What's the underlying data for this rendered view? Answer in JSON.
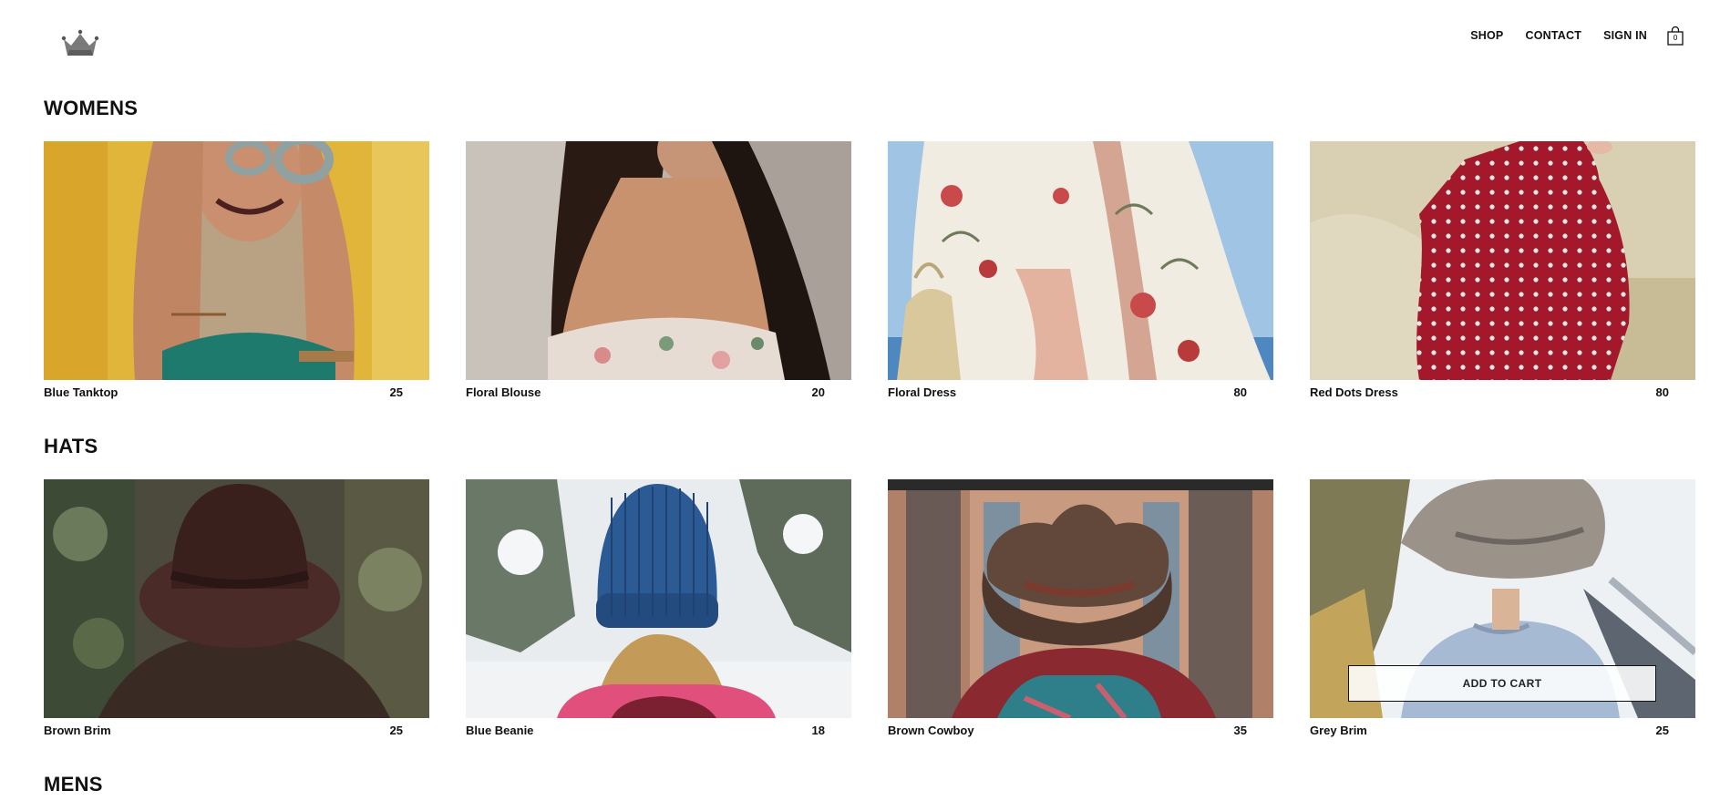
{
  "header": {
    "logo": "crown-logo-icon",
    "nav": [
      {
        "label": "SHOP"
      },
      {
        "label": "CONTACT"
      },
      {
        "label": "SIGN IN"
      }
    ],
    "cart_count": "0"
  },
  "sections": [
    {
      "title": "WOMENS",
      "items": [
        {
          "name": "Blue Tanktop",
          "price": "25"
        },
        {
          "name": "Floral Blouse",
          "price": "20"
        },
        {
          "name": "Floral Dress",
          "price": "80"
        },
        {
          "name": "Red Dots Dress",
          "price": "80"
        }
      ]
    },
    {
      "title": "HATS",
      "items": [
        {
          "name": "Brown Brim",
          "price": "25"
        },
        {
          "name": "Blue Beanie",
          "price": "18"
        },
        {
          "name": "Brown Cowboy",
          "price": "35"
        },
        {
          "name": "Grey Brim",
          "price": "25"
        }
      ]
    },
    {
      "title": "MENS"
    }
  ],
  "add_to_cart_label": "ADD TO CART"
}
